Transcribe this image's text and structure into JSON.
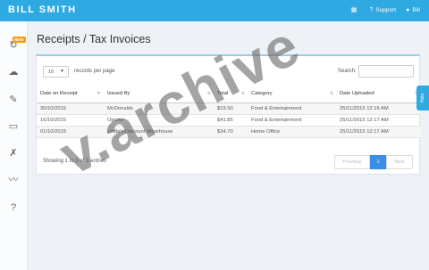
{
  "header": {
    "title": "BILL SMITH",
    "support_label": "Support",
    "user_label": "Bill"
  },
  "sidebar": {
    "badge": "NEW"
  },
  "page": {
    "title": "Receipts / Tax Invoices"
  },
  "table_controls": {
    "length_value": "10",
    "length_label": "records per page",
    "search_label": "Search:"
  },
  "table": {
    "columns": [
      "Date on Receipt",
      "Issued By",
      "Total",
      "Category",
      "Date Uploaded"
    ],
    "rows": [
      [
        "30/10/2015",
        "McDonalds",
        "$19.50",
        "Food & Entertainment",
        "25/11/2015 12:16 AM"
      ],
      [
        "16/10/2015",
        "Oporto",
        "$41.85",
        "Food & Entertainment",
        "25/11/2015 12:17 AM"
      ],
      [
        "01/10/2015",
        "Linda's Discount Warehouse",
        "$34.70",
        "Home Office",
        "25/11/2015 12:17 AM"
      ]
    ]
  },
  "footer": {
    "info": "Showing 1 to 3 of 3 entries",
    "prev": "Previous",
    "page": "1",
    "next": "Next"
  },
  "help_tab": "Help",
  "watermark": "v.archive"
}
